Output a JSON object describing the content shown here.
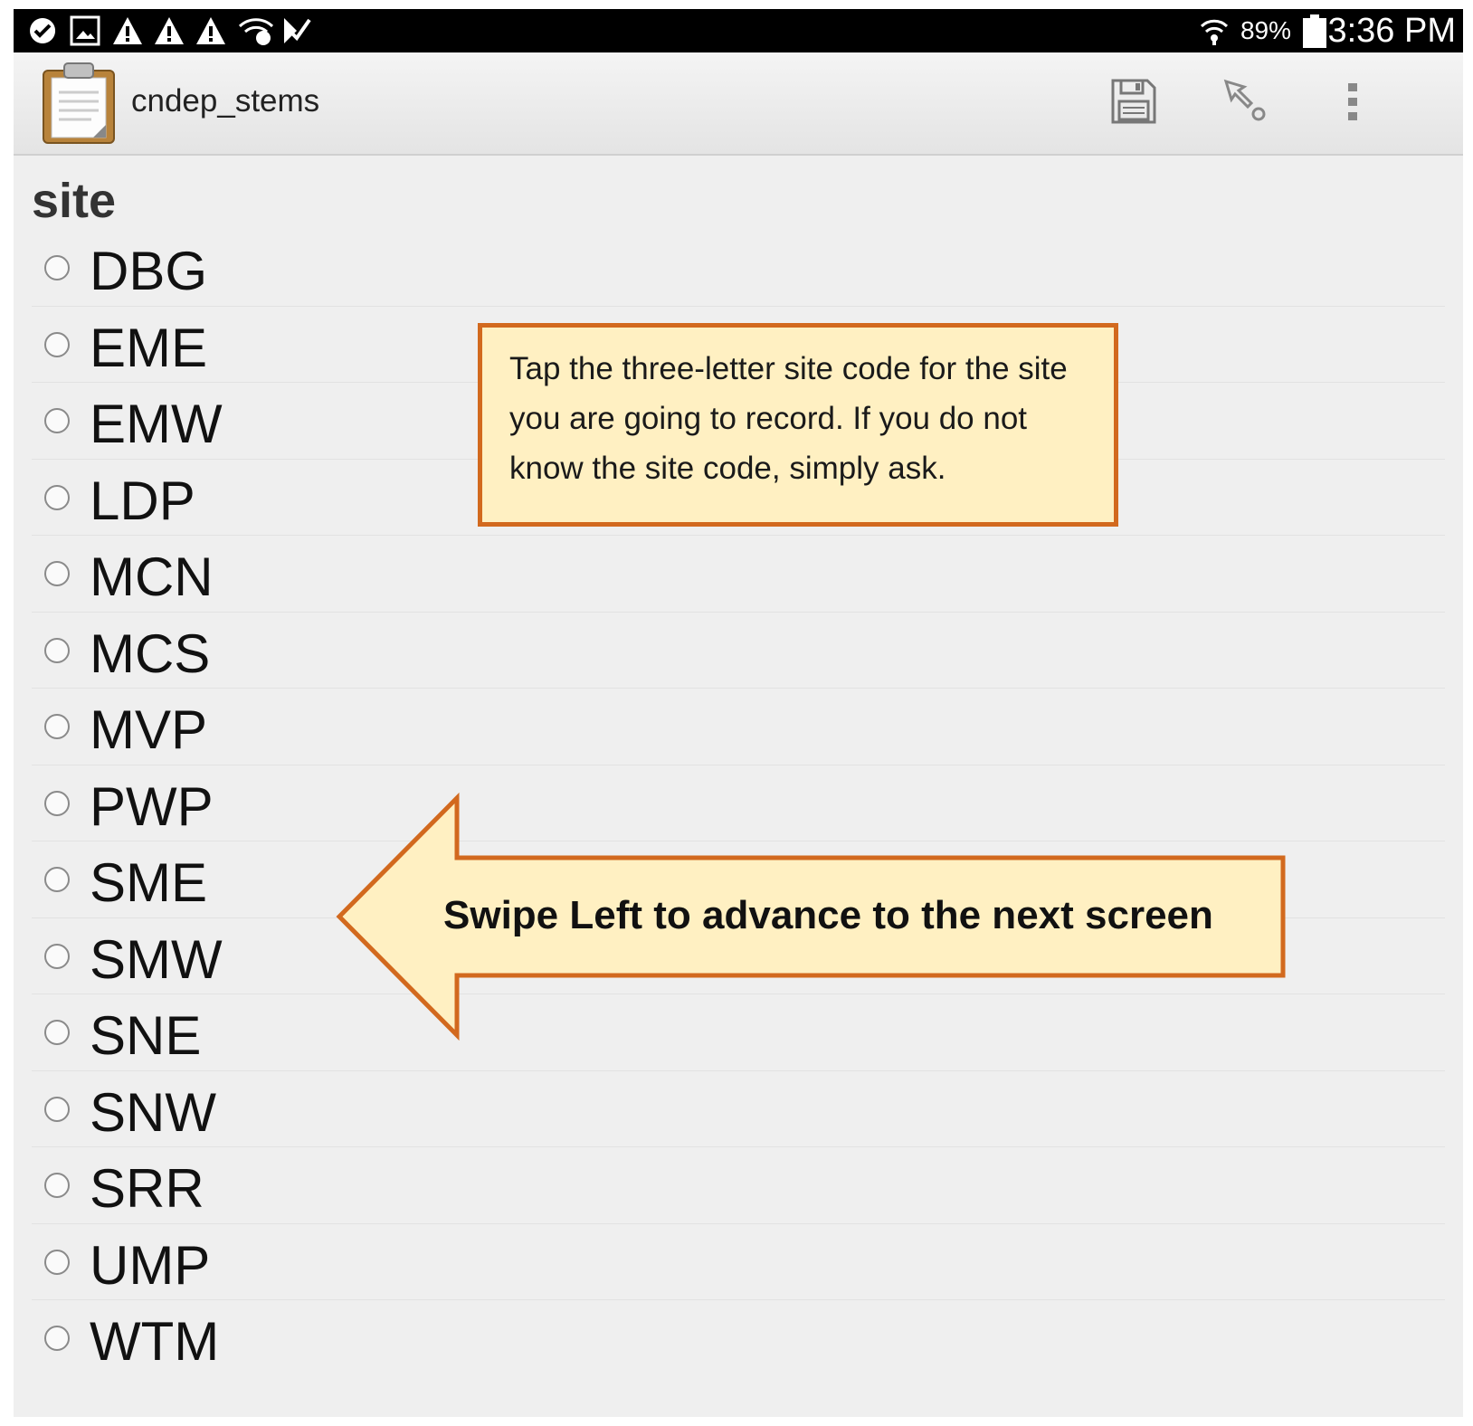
{
  "status_bar": {
    "battery_percent": "89%",
    "time": "3:36 PM"
  },
  "action_bar": {
    "app_title": "cndep_stems"
  },
  "question": {
    "label": "site",
    "choices": [
      "DBG",
      "EME",
      "EMW",
      "LDP",
      "MCN",
      "MCS",
      "MVP",
      "PWP",
      "SME",
      "SMW",
      "SNE",
      "SNW",
      "SRR",
      "UMP",
      "WTM"
    ]
  },
  "annotations": {
    "callout_text": "Tap the three-letter site code for the site you are going to record.  If you do not know the site code, simply ask.",
    "arrow_text": "Swipe Left to advance to the next screen"
  },
  "colors": {
    "callout_fill": "#fff0c2",
    "callout_border": "#d2691e"
  }
}
